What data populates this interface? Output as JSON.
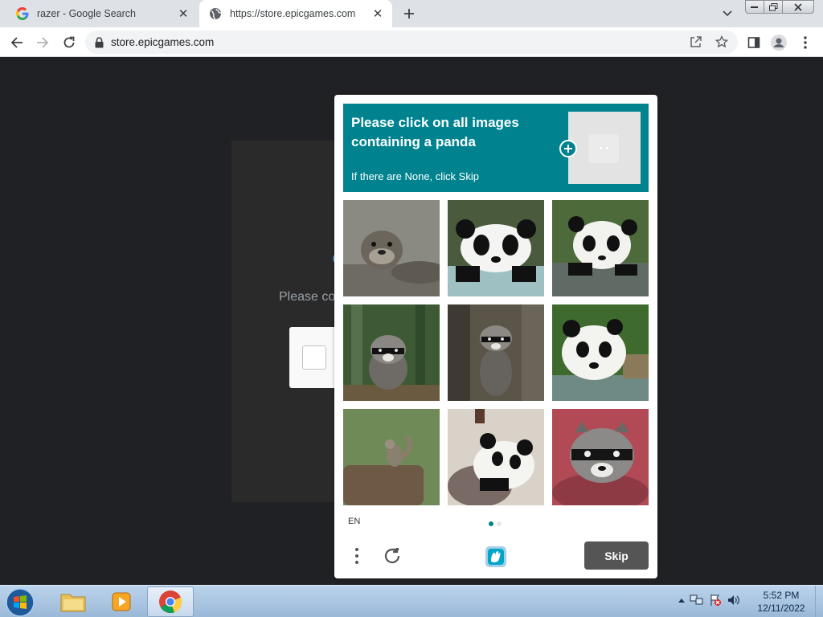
{
  "browser": {
    "tabs": [
      {
        "title": "razer - Google Search",
        "favicon": "google-g-icon",
        "active": false
      },
      {
        "title": "https://store.epicgames.com",
        "favicon": "globe-icon",
        "active": true
      }
    ],
    "address": "store.epicgames.com"
  },
  "page": {
    "partial_text": "Please co"
  },
  "captcha": {
    "prompt_line": "Please click on all images containing a panda",
    "prompt_sub": "If there are None, click Skip",
    "language": "EN",
    "skip_label": "Skip",
    "tiles": [
      {
        "name": "otter"
      },
      {
        "name": "panda"
      },
      {
        "name": "panda"
      },
      {
        "name": "raccoon"
      },
      {
        "name": "raccoon"
      },
      {
        "name": "panda"
      },
      {
        "name": "squirrel"
      },
      {
        "name": "panda"
      },
      {
        "name": "raccoon"
      }
    ],
    "accent_color": "#00838f"
  },
  "taskbar": {
    "time": "5:52 PM",
    "date": "12/11/2022"
  }
}
